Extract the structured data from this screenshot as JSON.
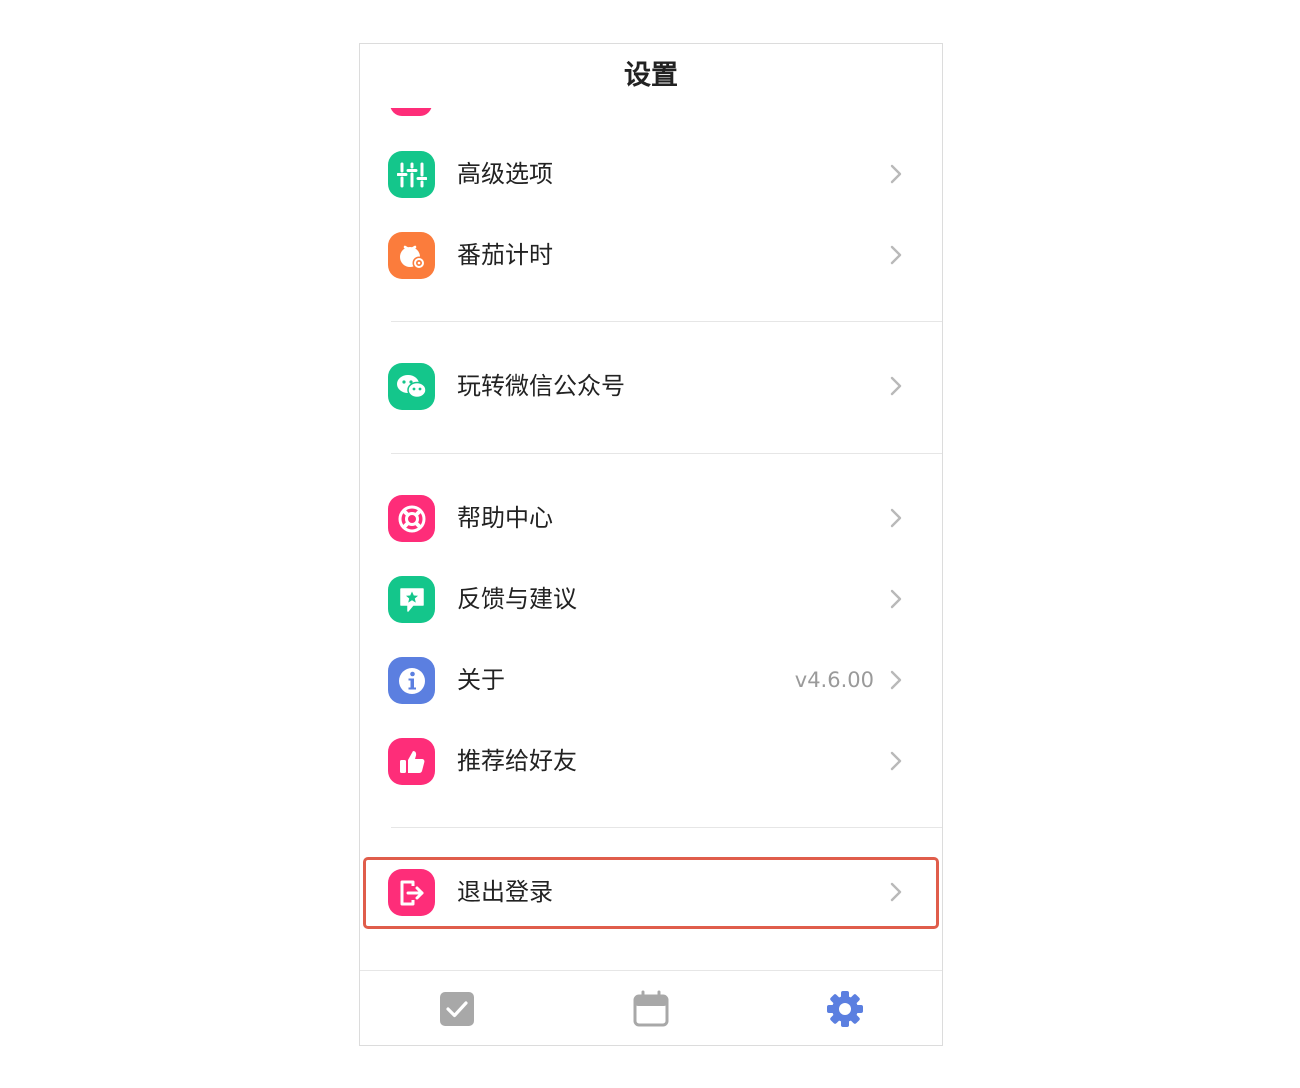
{
  "header": {
    "title": "设置"
  },
  "groups": [
    {
      "items": [
        {
          "label": "高级选项",
          "icon": "sliders-icon",
          "color": "#14c68b"
        },
        {
          "label": "番茄计时",
          "icon": "tomato-timer-icon",
          "color": "#fb7c3c"
        }
      ]
    },
    {
      "items": [
        {
          "label": "玩转微信公众号",
          "icon": "wechat-icon",
          "color": "#14c68b"
        }
      ]
    },
    {
      "items": [
        {
          "label": "帮助中心",
          "icon": "lifebuoy-icon",
          "color": "#fe2d79"
        },
        {
          "label": "反馈与建议",
          "icon": "feedback-icon",
          "color": "#14c68b"
        },
        {
          "label": "关于",
          "icon": "info-icon",
          "color": "#5b7fe0",
          "value": "v4.6.00"
        },
        {
          "label": "推荐给好友",
          "icon": "thumbs-up-icon",
          "color": "#fe2d79"
        }
      ]
    },
    {
      "items": [
        {
          "label": "退出登录",
          "icon": "logout-icon",
          "color": "#fe2d79",
          "highlighted": true
        }
      ]
    }
  ],
  "tabbar": {
    "tabs": [
      {
        "icon": "checkbox-icon",
        "active": false
      },
      {
        "icon": "calendar-icon",
        "active": false
      },
      {
        "icon": "gear-icon",
        "active": true
      }
    ],
    "active_color": "#5b7fe0",
    "inactive_color": "#a8a8a8"
  },
  "highlight_color": "#e05d4b"
}
